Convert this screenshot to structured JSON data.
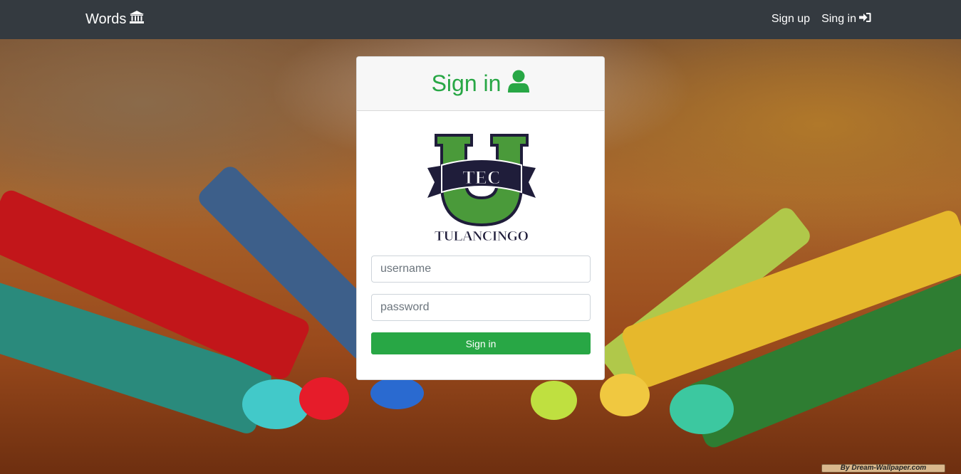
{
  "navbar": {
    "brand": "Words",
    "brand_icon": "bank-icon",
    "links": [
      {
        "label": "Sign up"
      },
      {
        "label": "Sing in",
        "icon": "sign-in-icon"
      }
    ],
    "background": "#343a40"
  },
  "card": {
    "title": "Sign in",
    "title_icon": "user-icon",
    "accent": "#28a745",
    "logo": {
      "letters": "TEC",
      "caption": "TULANCINGO"
    },
    "username_placeholder": "username",
    "password_placeholder": "password",
    "submit_label": "Sign in"
  },
  "watermark": "By Dream-Wallpaper.com"
}
